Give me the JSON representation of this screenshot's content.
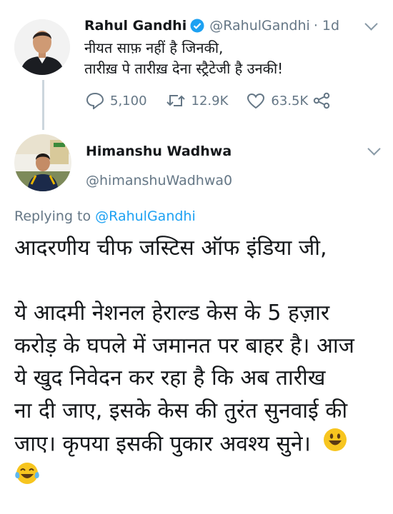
{
  "tweet1": {
    "name": "Rahul Gandhi",
    "handle": "@RahulGandhi",
    "time": "· 1d",
    "lines": [
      "नीयत साफ़ नहीं है जिनकी,",
      "तारीख़ पे तारीख़ देना स्ट्रैटेजी है उनकी!"
    ],
    "replies": "5,100",
    "retweets": "12.9K",
    "likes": "63.5K",
    "icons": [
      "verified-badge-icon",
      "reply-icon",
      "retweet-icon",
      "like-icon",
      "share-icon",
      "chevron-down-icon"
    ]
  },
  "tweet2": {
    "name": "Himanshu Wadhwa",
    "handle": "@himanshuWadhwa0",
    "replying_prefix": "Replying to",
    "replying_handle": "@RahulGandhi",
    "paragraph1": "आदरणीय चीफ जस्टिस ऑफ इंडिया जी,",
    "paragraph2_lines": [
      "ये आदमी नेशनल हेराल्ड केस के 5 हज़ार",
      "करोड़ के घपले में जमानत पर बाहर है। आज",
      "ये खुद निवेदन कर रहा है कि अब तारीख",
      "ना दी जाए, इसके केस की तुरंत सुनवाई की",
      "जाए। कृपया इसकी पुकार अवश्य सुने।"
    ],
    "emojis": [
      "smiley-emoji",
      "laughing-tears-emoji"
    ]
  },
  "colors": {
    "link": "#1da1f2",
    "muted": "#657786",
    "verified": "#1da1f2",
    "text": "#14171a"
  }
}
